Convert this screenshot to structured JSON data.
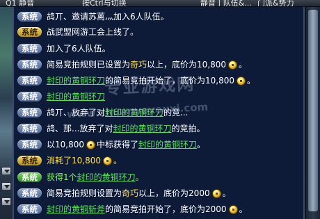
{
  "topbar": {
    "left_fragment": "Q1  静音",
    "middle_fragment": "按Ctrl与切换",
    "right_fragment1": "静音 | 队伍&...",
    "right_fragment2": "门派&势力"
  },
  "badges": {
    "system": "系统"
  },
  "chat": {
    "line1": {
      "text": "鸪丌、邀请苏蓠灬加入6人队伍。"
    },
    "line2": {
      "text": "战武盟网游工会上线了。"
    },
    "line3": {
      "text": "加入了6人队伍。"
    },
    "line4": {
      "prefix": "简易竞拍规则已设置为",
      "grade": "奇巧",
      "middle": "以上，底价为",
      "price": "10,800",
      "suffix": "。"
    },
    "line5": {
      "item": "封印的黄铜环刀",
      "middle": "的简易竞拍开始了，底价为",
      "price": "10,800",
      "suffix": "。"
    },
    "line6": {
      "item": "封印的黄铜环刀",
      "tail": ""
    },
    "line7": {
      "prefix": "鸪丌、放弃了对",
      "item": "封印的黄铜环刀",
      "suffix": "的竞..."
    },
    "line8": {
      "prefix": "鸪、那...放弃了对",
      "item": "封印的黄铜环刀",
      "suffix": "的竞拍。"
    },
    "line9": {
      "prefix": "以",
      "price": "10,800",
      "middle": "中标获得了",
      "item": "封印的黄铜环刀",
      "suffix": "。"
    },
    "line10": {
      "text": "消耗了10,800",
      "suffix": "。"
    },
    "line11": {
      "prefix": "获得1个",
      "item": "封印的黄铜环刀",
      "suffix": "。"
    },
    "line12": {
      "prefix": "简易竞拍规则设置为",
      "grade": "奇巧",
      "middle": "以上，底价为",
      "price": "2000",
      "suffix": "。"
    },
    "line13": {
      "item": "封印的黄铜斩斧",
      "middle": "的简易竞拍开始了，底价为",
      "price": "2000",
      "suffix": "。"
    }
  },
  "watermark": {
    "cn": "专业游戏网",
    "url": "www.zhuanyeyouxi.com"
  },
  "colors": {
    "panel": "#0e1c3a",
    "item_link": "#58e25a",
    "grade_text": "#ffe040",
    "badge_blue": "#6b80ad",
    "badge_gold": "#d8b63a",
    "badge_green": "#4caf3a"
  }
}
